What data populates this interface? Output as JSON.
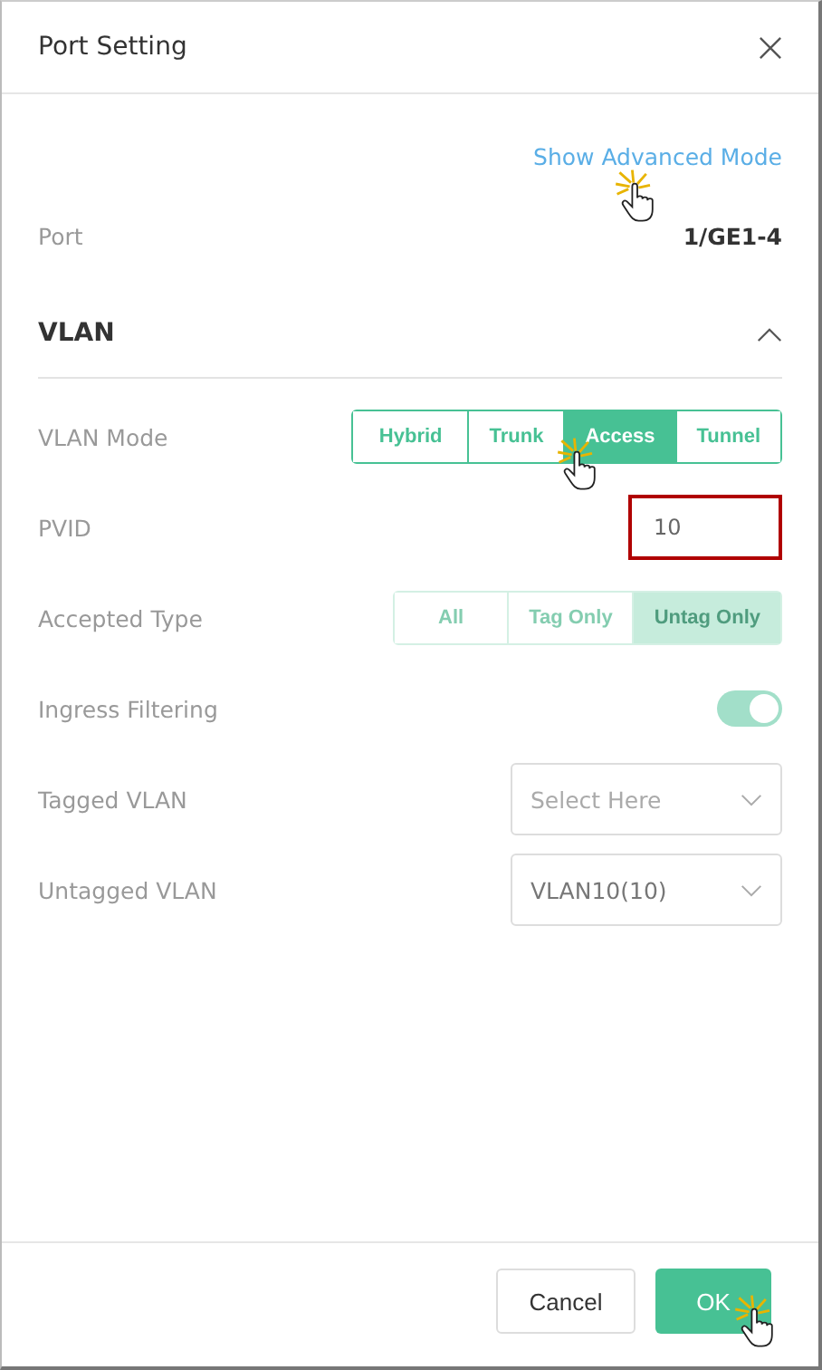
{
  "dialog": {
    "title": "Port Setting"
  },
  "advanced_link": "Show Advanced Mode",
  "port": {
    "label": "Port",
    "value": "1/GE1-4"
  },
  "section": {
    "title": "VLAN",
    "expanded": true
  },
  "fields": [
    {
      "kind": "segmented",
      "label": "VLAN Mode",
      "disabled": false,
      "options": [
        {
          "label": "Hybrid",
          "selected": false
        },
        {
          "label": "Trunk",
          "selected": false
        },
        {
          "label": "Access",
          "selected": true
        },
        {
          "label": "Tunnel",
          "selected": false
        }
      ]
    },
    {
      "kind": "input",
      "label": "PVID",
      "value": "10",
      "highlighted": true
    },
    {
      "kind": "segmented",
      "label": "Accepted Type",
      "disabled": true,
      "options": [
        {
          "label": "All",
          "selected": false
        },
        {
          "label": "Tag Only",
          "selected": false
        },
        {
          "label": "Untag Only",
          "selected": true
        }
      ]
    },
    {
      "kind": "toggle",
      "label": "Ingress Filtering",
      "on": true,
      "disabled": true
    },
    {
      "kind": "select",
      "label": "Tagged VLAN",
      "placeholder": "Select Here"
    },
    {
      "kind": "select",
      "label": "Untagged VLAN",
      "value": "VLAN10(10)"
    }
  ],
  "buttons": [
    {
      "label": "Cancel",
      "kind": "secondary"
    },
    {
      "label": "OK",
      "kind": "primary"
    }
  ]
}
